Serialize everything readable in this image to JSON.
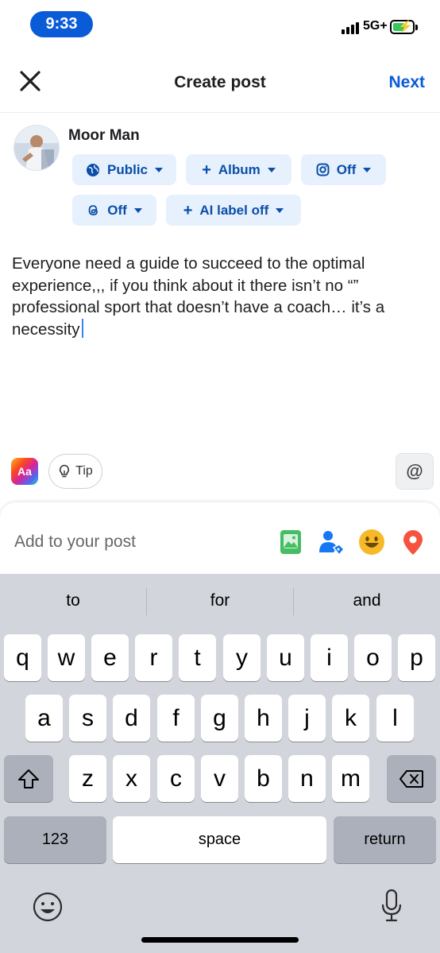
{
  "status_bar": {
    "time": "9:33",
    "network": "5G+"
  },
  "header": {
    "title": "Create post",
    "next_label": "Next"
  },
  "user": {
    "name": "Moor Man"
  },
  "chips": {
    "audience": "Public",
    "album": "Album",
    "instagram": "Off",
    "threads": "Off",
    "ai_label": "AI label off"
  },
  "post": {
    "text": "Everyone need a guide to succeed to the optimal experience,,, if you think about it there isn’t no “” professional sport that doesn’t have a coach… it’s a necessity"
  },
  "tools": {
    "aa_label": "Aa",
    "tip_label": "Tip",
    "mention_label": "@"
  },
  "add_to_post": {
    "label": "Add to your post",
    "icons": [
      "photo-icon",
      "tag-people-icon",
      "feeling-icon",
      "location-icon"
    ]
  },
  "keyboard": {
    "suggestions": [
      "to",
      "for",
      "and"
    ],
    "row1": [
      "q",
      "w",
      "e",
      "r",
      "t",
      "y",
      "u",
      "i",
      "o",
      "p"
    ],
    "row2": [
      "a",
      "s",
      "d",
      "f",
      "g",
      "h",
      "j",
      "k",
      "l"
    ],
    "row3": [
      "z",
      "x",
      "c",
      "v",
      "b",
      "n",
      "m"
    ],
    "numbers_label": "123",
    "space_label": "space",
    "return_label": "return"
  },
  "colors": {
    "accent": "#0a5bd8",
    "chip_bg": "#e7f1fd",
    "chip_text": "#0a4ea8",
    "keyboard_bg": "#d2d5db"
  }
}
